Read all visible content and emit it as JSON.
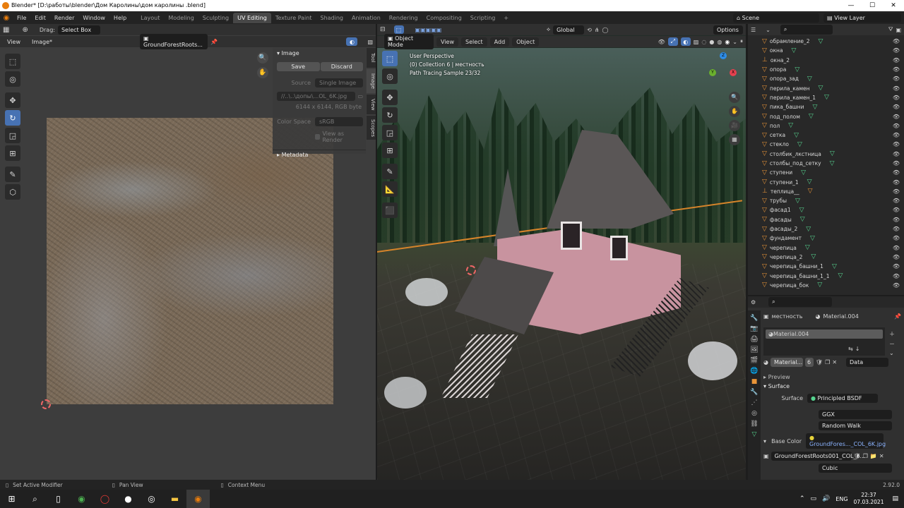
{
  "window": {
    "title": "Blender* [D:\\работы\\blender\\Дом Каролины\\дом каролины .blend]",
    "minimize": "—",
    "maximize": "☐",
    "close": "✕"
  },
  "menu": [
    "File",
    "Edit",
    "Render",
    "Window",
    "Help"
  ],
  "workspaces": [
    "Layout",
    "Modeling",
    "Sculpting",
    "UV Editing",
    "Texture Paint",
    "Shading",
    "Animation",
    "Rendering",
    "Compositing",
    "Scripting",
    "+"
  ],
  "active_workspace_index": 3,
  "scene": {
    "name": "Scene",
    "view_layer": "View Layer"
  },
  "uv_editor": {
    "drag_label": "Drag:",
    "drag_value": "Select Box",
    "view_menu": "View",
    "image_menu": "Image*",
    "image_name": "GroundForestRoots...",
    "sidebar_tabs": [
      "Tool",
      "Image",
      "View",
      "Scopes"
    ],
    "image_panel": {
      "title": "Image",
      "save": "Save",
      "discard": "Discard",
      "source_label": "Source",
      "source_value": "Single Image",
      "filepath": "//..\\..\\допы\\...OL_6K.jpg",
      "info": "6144 x 6144,  RGB byte",
      "color_space_label": "Color Space",
      "color_space_value": "sRGB",
      "view_as_render": "View as Render"
    },
    "metadata_title": "Metadata"
  },
  "viewport": {
    "mode": "Object Mode",
    "menus": [
      "View",
      "Select",
      "Add",
      "Object"
    ],
    "transform": "Global",
    "options": "Options",
    "overlay_lines": [
      "User Perspective",
      "(0) Collection 6 | местность",
      "Path Tracing Sample 23/32"
    ],
    "gizmo": {
      "x": "X",
      "y": "Y",
      "z": "Z"
    }
  },
  "outliner": {
    "items": [
      "обрамление_2",
      "окна",
      "окна_2",
      "опора",
      "опора_зад",
      "перила_камен",
      "перила_камен_1",
      "пика_башни",
      "под_полом",
      "пол",
      "сетка",
      "стекло",
      "столбик_лкстница",
      "столбы_под_сетку",
      "ступени",
      "ступени_1",
      "теплица__",
      "трубы",
      "фасад1",
      "фасады",
      "фасады_2",
      "фундамент",
      "черепица",
      "черепица_2",
      "черепица_башни_1",
      "черепица_башни_1_1",
      "черепица_бок"
    ]
  },
  "properties": {
    "object_name": "местность",
    "material_name": "Material.004",
    "slot_name": "Material.004",
    "material_field": "Material...",
    "user_count": "6",
    "link": "Data",
    "preview": "Preview",
    "surface_section": "Surface",
    "surface_label": "Surface",
    "surface_value": "Principled BSDF",
    "distribution": "GGX",
    "subsurface": "Random Walk",
    "base_color_label": "Base Color",
    "base_color_value": "GroundFores..._COL_6K.jpg",
    "texture_name": "GroundForestRoots001_COL_6...",
    "interpolation": "Cubic"
  },
  "statusbar": {
    "left": "Set Active Modifier",
    "mid": "Pan View",
    "right": "Context Menu",
    "version": "2.92.0"
  },
  "taskbar": {
    "lang": "ENG",
    "time": "22:37",
    "date": "07.03.2021"
  },
  "colors": {
    "accent": "#4772b3",
    "header": "#303030",
    "panel": "#3a3a3a",
    "orange": "#e87d0d"
  }
}
